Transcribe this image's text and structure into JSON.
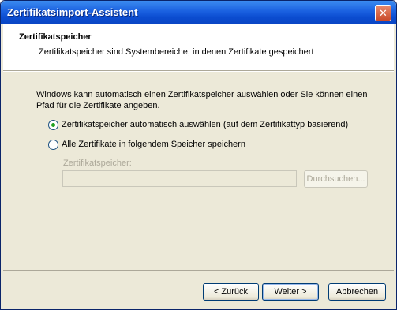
{
  "window": {
    "title": "Zertifikatsimport-Assistent",
    "close_glyph": "✕"
  },
  "header": {
    "title": "Zertifikatspeicher",
    "subtitle": "Zertifikatspeicher sind Systembereiche, in denen Zertifikate gespeichert"
  },
  "body": {
    "intro_line1": "Windows kann automatisch einen Zertifikatspeicher auswählen oder Sie können einen",
    "intro_line2": "Pfad für die Zertifikate angeben.",
    "options": [
      {
        "label": "Zertifikatspeicher automatisch auswählen (auf dem Zertifikattyp basierend)",
        "selected": true
      },
      {
        "label": "Alle Zertifikate in folgendem Speicher speichern",
        "selected": false
      }
    ],
    "store_label": "Zertifikatspeicher:",
    "store_value": "",
    "browse_label": "Durchsuchen..."
  },
  "footer": {
    "back_label": "< Zurück",
    "next_label": "Weiter >",
    "cancel_label": "Abbrechen"
  },
  "colors": {
    "titlebar": "#0b4cd0",
    "dialog_bg": "#ece9d8",
    "radio_dot": "#21a121"
  }
}
